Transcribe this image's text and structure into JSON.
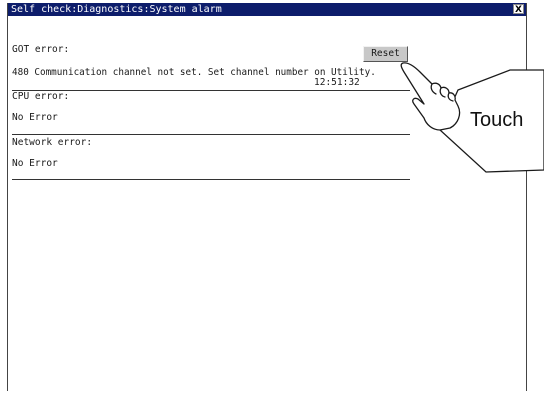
{
  "window": {
    "title": "Self check:Diagnostics:System alarm",
    "close_label": "X"
  },
  "got": {
    "label": "GOT error:",
    "message": "480 Communication channel not set. Set channel number on Utility.",
    "time": "12:51:32",
    "reset_label": "Reset"
  },
  "cpu": {
    "label": "CPU error:",
    "message": "No Error"
  },
  "network": {
    "label": "Network error:",
    "message": "No Error"
  },
  "callout": {
    "label": "Touch",
    "icon": "pointing-hand-icon"
  },
  "colors": {
    "titlebar": "#0d1d6b",
    "button": "#c8c8c8"
  }
}
